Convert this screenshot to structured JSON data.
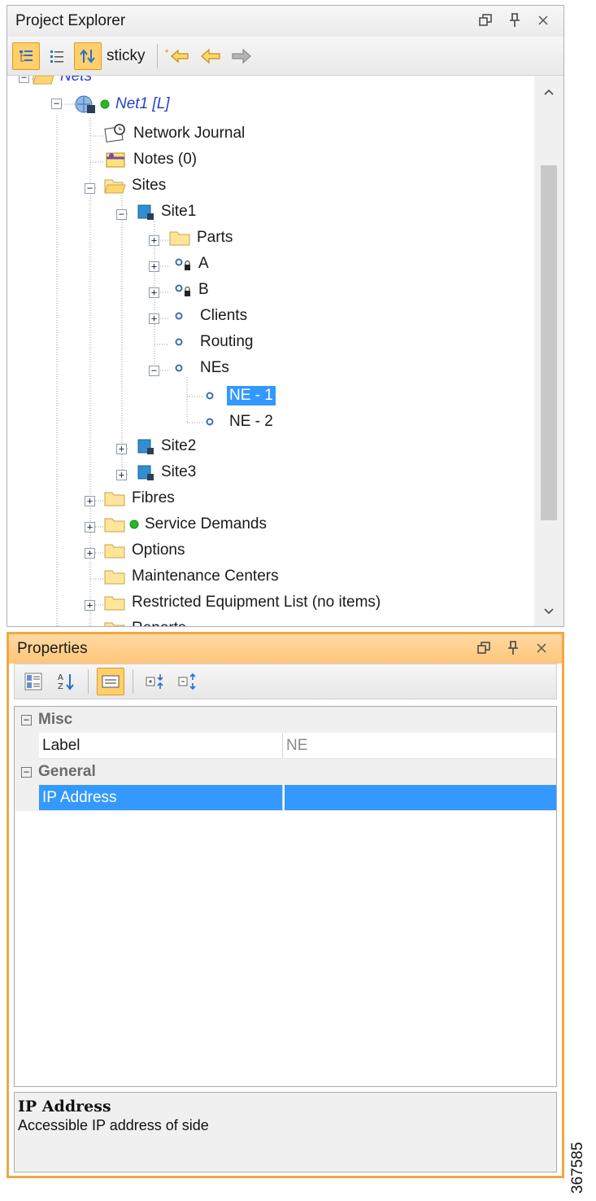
{
  "project_explorer": {
    "title": "Project Explorer",
    "header_buttons": [
      "restore-icon",
      "pin-icon",
      "close-icon"
    ],
    "toolbar": {
      "sticky_label": "sticky",
      "buttons": [
        "tree-view-icon",
        "list-view-icon",
        "sync-icon",
        "sticky",
        "back-new-icon",
        "back-icon",
        "forward-icon"
      ]
    },
    "tree": {
      "nets": "Nets",
      "net1": "Net1 [L]",
      "network_journal": "Network Journal",
      "notes": "Notes (0)",
      "sites": "Sites",
      "site1": "Site1",
      "parts": "Parts",
      "a": "A",
      "b": "B",
      "clients": "Clients",
      "routing": "Routing",
      "nes": "NEs",
      "ne1": "NE - 1",
      "ne2": "NE - 2",
      "site2": "Site2",
      "site3": "Site3",
      "fibres": "Fibres",
      "service_demands": "Service Demands",
      "options": "Options",
      "maintenance_centers": "Maintenance Centers",
      "restricted": "Restricted Equipment List (no items)",
      "reports": "Reports"
    },
    "selected_item": "NE - 1"
  },
  "properties": {
    "title": "Properties",
    "header_buttons": [
      "restore-icon",
      "pin-icon",
      "close-icon"
    ],
    "categories": {
      "misc": "Misc",
      "general": "General"
    },
    "rows": {
      "label_name": "Label",
      "label_value": "NE",
      "ip_name": "IP Address",
      "ip_value": ""
    },
    "description": {
      "title": "IP Address",
      "text": "Accessible IP address of side"
    }
  },
  "figure_id": "367585",
  "colors": {
    "selection": "#3399ff",
    "properties_accent": "#f2a745",
    "status_green": "#22bb22"
  }
}
